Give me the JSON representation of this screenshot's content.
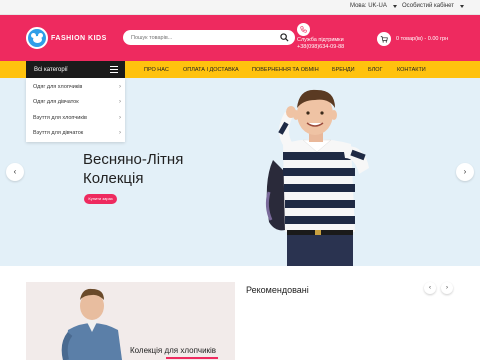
{
  "topbar": {
    "language": "Мова: UK-UA",
    "account": "Особистий кабінет"
  },
  "header": {
    "logo_text": "FASHION KIDS",
    "search_placeholder": "Пошук товарів...",
    "support_label": "Служба підтримки",
    "support_phone": "+38(098)634-09-88",
    "cart_text": "0 товар(ів) - 0.00 грн"
  },
  "nav": {
    "categories_label": "Всі категорії",
    "links": [
      "ПРО НАС",
      "ОПЛАТА І ДОСТАВКА",
      "ПОВЕРНЕННЯ ТА ОБМІН",
      "БРЕНДИ",
      "БЛОГ",
      "КОНТАКТИ"
    ]
  },
  "categories": [
    {
      "label": "Одяг для хлопчиків"
    },
    {
      "label": "Одяг для дівчаток"
    },
    {
      "label": "Взуття для хлопчиків"
    },
    {
      "label": "Взуття для дівчаток"
    }
  ],
  "hero": {
    "title_line1": "Весняно-Літня",
    "title_line2": "Колекція",
    "button_label": "Купити зараз",
    "prev_icon": "chevron-left-icon",
    "next_icon": "chevron-right-icon"
  },
  "lower": {
    "card_label": "Колекція для хлопчиків",
    "section_title": "Рекомендовані"
  },
  "colors": {
    "brand_pink": "#ee2a5f",
    "nav_yellow": "#ffc20e",
    "dark": "#1b1b1b",
    "hero_bg": "#e3f0f8",
    "logo_blue": "#2f9ee8"
  }
}
